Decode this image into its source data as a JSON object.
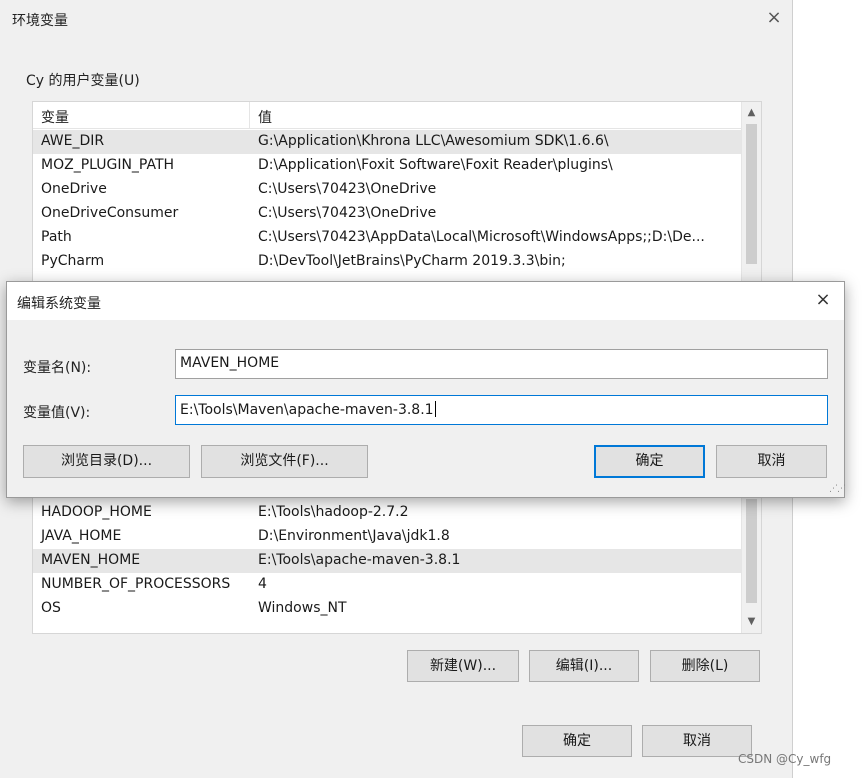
{
  "env_window": {
    "title": "环境变量",
    "close_glyph": "×",
    "user_group_label": "Cy 的用户变量(U)",
    "columns": {
      "name": "变量",
      "value": "值"
    },
    "user_vars": [
      {
        "name": "AWE_DIR",
        "value": "G:\\Application\\Khrona LLC\\Awesomium SDK\\1.6.6\\",
        "selected": true
      },
      {
        "name": "MOZ_PLUGIN_PATH",
        "value": "D:\\Application\\Foxit Software\\Foxit Reader\\plugins\\"
      },
      {
        "name": "OneDrive",
        "value": "C:\\Users\\70423\\OneDrive"
      },
      {
        "name": "OneDriveConsumer",
        "value": "C:\\Users\\70423\\OneDrive"
      },
      {
        "name": "Path",
        "value": "C:\\Users\\70423\\AppData\\Local\\Microsoft\\WindowsApps;;D:\\De..."
      },
      {
        "name": "PyCharm",
        "value": "D:\\DevTool\\JetBrains\\PyCharm 2019.3.3\\bin;"
      }
    ],
    "system_vars": [
      {
        "name": "HADOOP_HOME",
        "value": "E:\\Tools\\hadoop-2.7.2"
      },
      {
        "name": "JAVA_HOME",
        "value": "D:\\Environment\\Java\\jdk1.8"
      },
      {
        "name": "MAVEN_HOME",
        "value": "E:\\Tools\\apache-maven-3.8.1",
        "selected": true
      },
      {
        "name": "NUMBER_OF_PROCESSORS",
        "value": "4"
      },
      {
        "name": "OS",
        "value": "Windows_NT"
      }
    ],
    "system_buttons": {
      "new": "新建(W)...",
      "edit": "编辑(I)...",
      "delete": "删除(L)"
    },
    "ok": "确定",
    "cancel": "取消"
  },
  "edit_dialog": {
    "title": "编辑系统变量",
    "close_glyph": "×",
    "name_label": "变量名(N):",
    "name_value": "MAVEN_HOME",
    "value_label": "变量值(V):",
    "value_value": "E:\\Tools\\Maven\\apache-maven-3.8.1",
    "browse_dir": "浏览目录(D)...",
    "browse_file": "浏览文件(F)...",
    "ok": "确定",
    "cancel": "取消"
  },
  "watermark": "CSDN @Cy_wfg",
  "icons": {
    "scroll_up": "scroll-up-arrow-icon",
    "scroll_down": "scroll-down-arrow-icon",
    "close": "close-icon",
    "resize_grip": "resize-grip-icon"
  },
  "colors": {
    "window_bg": "#f0f0f0",
    "focus_blue": "#0078d7",
    "selection": "#e6e6e6"
  }
}
